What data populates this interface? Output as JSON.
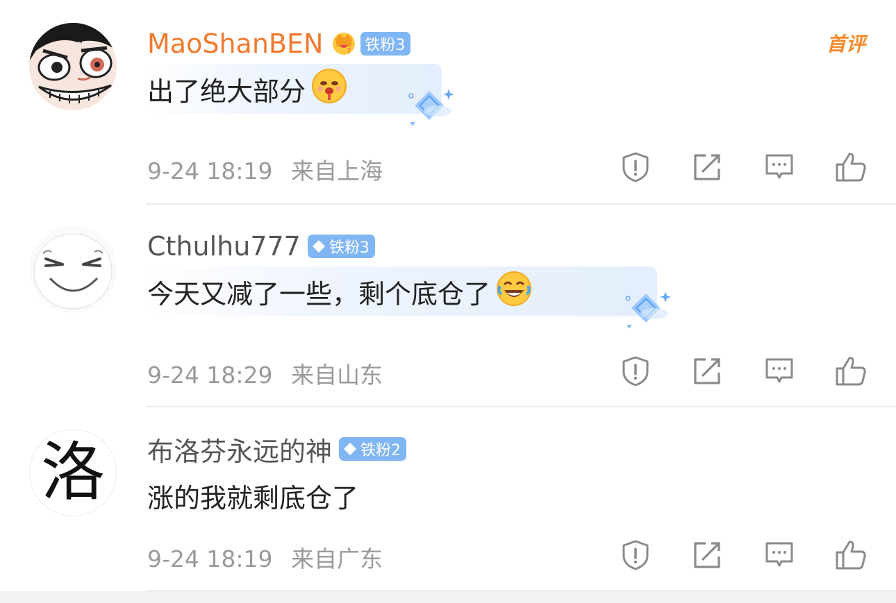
{
  "comments": [
    {
      "avatar": "luffy-cartoon-avatar",
      "name": "MaoShanBEN",
      "name_color": "#f07a30",
      "has_crown": true,
      "badge": "铁粉3",
      "text": "出了绝大部分",
      "emoji": "shocked-bleeding-emoji",
      "time": "9-24 18:19",
      "location": "来自上海",
      "tag": "首评"
    },
    {
      "avatar": "sketch-smile-face-avatar",
      "name": "Cthulhu777",
      "badge": "铁粉3",
      "text": "今天又减了一些，剩个底仓了",
      "emoji": "crying-laughing-emoji",
      "time": "9-24 18:29",
      "location": "来自山东"
    },
    {
      "avatar_char": "洛",
      "name": "布洛芬永远的神",
      "badge": "铁粉2",
      "text": "涨的我就剩底仓了",
      "time": "9-24 18:19",
      "location": "来自广东"
    }
  ],
  "colors": {
    "badge_bg": "#7fb6f3",
    "meta_text": "#9a9a9a",
    "icon": "#8a8a8a",
    "vip_name": "#f07a30"
  }
}
